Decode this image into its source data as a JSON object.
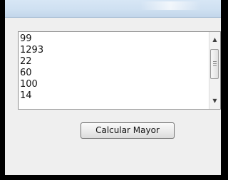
{
  "listbox": {
    "items": [
      "99",
      "1293",
      "22",
      "60",
      "100",
      "14"
    ],
    "scroll_up_icon": "triangle-up",
    "scroll_down_icon": "triangle-down"
  },
  "actions": {
    "calcular_label": "Calcular Mayor"
  }
}
